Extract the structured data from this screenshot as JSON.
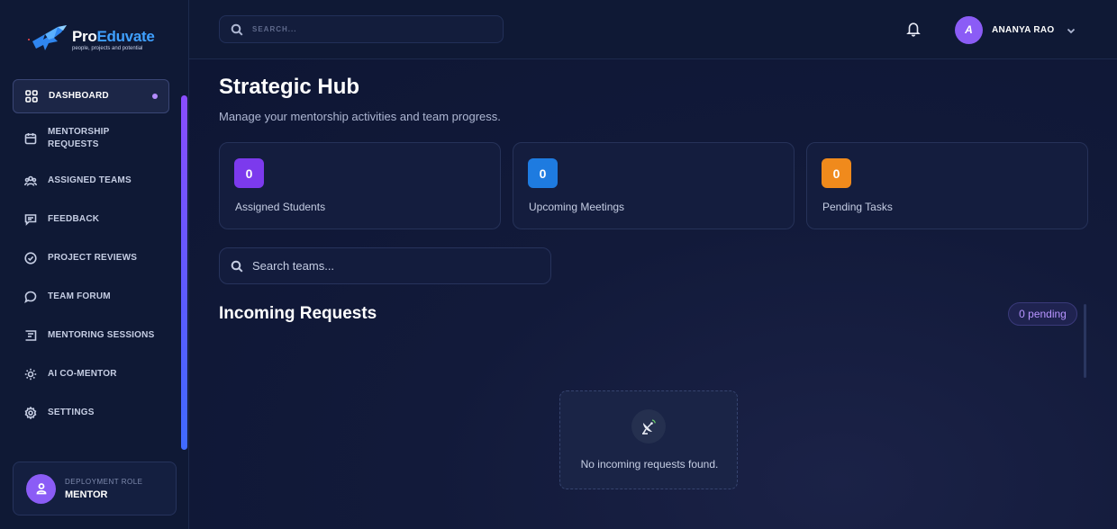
{
  "brand": {
    "name_part1": "Pro",
    "name_part2": "Eduvate",
    "tagline": "people, projects and potential"
  },
  "sidebar": {
    "items": [
      {
        "label": "DASHBOARD",
        "icon": "grid-icon",
        "active": true
      },
      {
        "label": "MENTORSHIP\nREQUESTS",
        "icon": "calendar-icon",
        "active": false
      },
      {
        "label": "ASSIGNED TEAMS",
        "icon": "users-icon",
        "active": false
      },
      {
        "label": "FEEDBACK",
        "icon": "message-icon",
        "active": false
      },
      {
        "label": "PROJECT REVIEWS",
        "icon": "check-circle-icon",
        "active": false
      },
      {
        "label": "TEAM FORUM",
        "icon": "chat-bubble-icon",
        "active": false
      },
      {
        "label": "MENTORING SESSIONS",
        "icon": "sessions-icon",
        "active": false
      },
      {
        "label": "AI CO-MENTOR",
        "icon": "sun-icon",
        "active": false
      },
      {
        "label": "SETTINGS",
        "icon": "gear-icon",
        "active": false
      }
    ],
    "role": {
      "caption": "DEPLOYMENT ROLE",
      "value": "MENTOR"
    }
  },
  "header": {
    "search_placeholder": "SEARCH...",
    "user": {
      "initial": "A",
      "name": "ANANYA RAO"
    }
  },
  "main": {
    "title": "Strategic Hub",
    "subtitle": "Manage your mentorship activities and team progress.",
    "stats": [
      {
        "value": "0",
        "label": "Assigned Students",
        "color": "#7c3aed"
      },
      {
        "value": "0",
        "label": "Upcoming Meetings",
        "color": "#1e7be0"
      },
      {
        "value": "0",
        "label": "Pending Tasks",
        "color": "#f08a1c"
      }
    ],
    "team_search_placeholder": "Search teams...",
    "requests": {
      "title": "Incoming Requests",
      "badge": "0 pending",
      "empty_text": "No incoming requests found."
    }
  },
  "colors": {
    "accent": "#8b5cf6",
    "background": "#0d1530",
    "pending_text": "#b794ff"
  }
}
